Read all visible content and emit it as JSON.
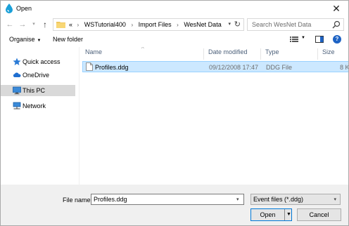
{
  "window": {
    "title": "Open",
    "close_glyph": "✕"
  },
  "nav": {
    "back_glyph": "←",
    "forward_glyph": "→",
    "recent_glyph": "▾",
    "up_glyph": "↑"
  },
  "address": {
    "overflow": "«",
    "crumbs": [
      "WSTutorial400",
      "Import Files",
      "WesNet Data"
    ],
    "separator": "›",
    "dropdown_glyph": "▾",
    "refresh_glyph": "↻"
  },
  "search": {
    "placeholder": "Search WesNet Data"
  },
  "toolbar": {
    "organise_label": "Organise",
    "organise_caret": "▼",
    "new_folder_label": "New folder",
    "view_caret": "▼",
    "help_glyph": "?"
  },
  "sidebar": {
    "items": [
      {
        "label": "Quick access",
        "icon": "star-icon"
      },
      {
        "label": "OneDrive",
        "icon": "cloud-icon"
      },
      {
        "label": "This PC",
        "icon": "computer-icon",
        "selected": true
      },
      {
        "label": "Network",
        "icon": "network-icon"
      }
    ]
  },
  "filelist": {
    "sort_glyph": "^",
    "columns": {
      "name": "Name",
      "date": "Date modified",
      "type": "Type",
      "size": "Size"
    },
    "rows": [
      {
        "name": "Profiles.ddg",
        "date": "09/12/2008 17:47",
        "type": "DDG File",
        "size": "8 K"
      }
    ]
  },
  "bottom": {
    "file_name_label": "File name:",
    "file_name_value": "Profiles.ddg",
    "file_name_caret": "▾",
    "file_type_value": "Event files (*.ddg)",
    "file_type_caret": "▾",
    "open_label": "Open",
    "open_split_caret": "▼",
    "cancel_label": "Cancel"
  },
  "colors": {
    "selection_bg": "#cce8ff",
    "selection_border": "#99d1ff",
    "accent": "#0078d7",
    "header_text": "#4c607a"
  }
}
